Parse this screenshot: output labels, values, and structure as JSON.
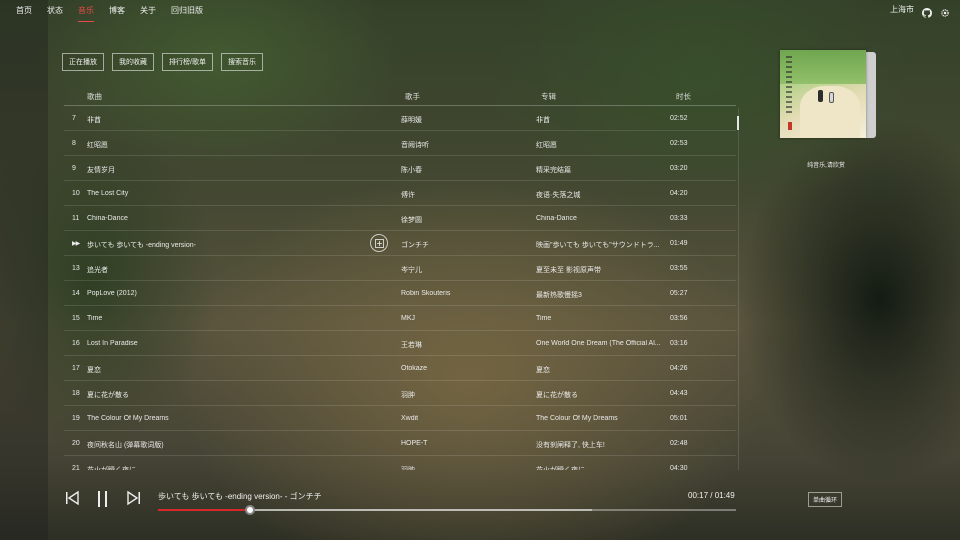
{
  "nav": {
    "items": [
      {
        "label": "首页"
      },
      {
        "label": "状态"
      },
      {
        "label": "音乐"
      },
      {
        "label": "博客"
      },
      {
        "label": "关于"
      },
      {
        "label": "回归旧版"
      }
    ],
    "active_index": 2,
    "city": "上海市",
    "icons": [
      "github-icon",
      "gear-icon"
    ]
  },
  "tabs": [
    {
      "label": "正在播放"
    },
    {
      "label": "我的收藏"
    },
    {
      "label": "排行榜/歌单"
    },
    {
      "label": "搜索音乐"
    }
  ],
  "table": {
    "headers": {
      "title": "歌曲",
      "artist": "歌手",
      "album": "专辑",
      "duration": "时长"
    },
    "rows": [
      {
        "idx": "7",
        "title": "非酋",
        "artist": "薛明媛",
        "album": "非酋",
        "duration": "02:52"
      },
      {
        "idx": "8",
        "title": "红昭愿",
        "artist": "音阙诗听",
        "album": "红昭愿",
        "duration": "02:53"
      },
      {
        "idx": "9",
        "title": "友情岁月",
        "artist": "陈小春",
        "album": "精采完结篇",
        "duration": "03:20"
      },
      {
        "idx": "10",
        "title": "The Lost City",
        "artist": "傅许",
        "album": "夜语·失落之城",
        "duration": "04:20"
      },
      {
        "idx": "11",
        "title": "China-Dance",
        "artist": "徐梦圆",
        "album": "China-Dance",
        "duration": "03:33"
      },
      {
        "idx": "▶▶",
        "title": "歩いても 歩いても -ending version-",
        "artist": "ゴンチチ",
        "album": "映画\"歩いても 歩いても\"サウンドトラ...",
        "duration": "01:49",
        "playing": true
      },
      {
        "idx": "13",
        "title": "追光者",
        "artist": "岑宁儿",
        "album": "夏至未至 影视原声带",
        "duration": "03:55"
      },
      {
        "idx": "14",
        "title": "PopLove (2012)",
        "artist": "Robin Skouteris",
        "album": "最新热歌慢摇3",
        "duration": "05:27"
      },
      {
        "idx": "15",
        "title": "Time",
        "artist": "MKJ",
        "album": "Time",
        "duration": "03:56"
      },
      {
        "idx": "16",
        "title": "Lost In Paradise",
        "artist": "王若琳",
        "album": "One World One Dream (The Official Al...",
        "duration": "03:16"
      },
      {
        "idx": "17",
        "title": "夏恋",
        "artist": "Otokaze",
        "album": "夏恋",
        "duration": "04:26"
      },
      {
        "idx": "18",
        "title": "夏に花が散る",
        "artist": "羽肿",
        "album": "夏に花が散る",
        "duration": "04:43"
      },
      {
        "idx": "19",
        "title": "The Colour Of My Dreams",
        "artist": "Xwdit",
        "album": "The Colour Of My Dreams",
        "duration": "05:01"
      },
      {
        "idx": "20",
        "title": "夜间秋名山 (弹幕歌词版)",
        "artist": "HOPE-T",
        "album": "没有刹闸释了, 快上车!",
        "duration": "02:48"
      },
      {
        "idx": "21",
        "title": "花火が瞬く夜に",
        "artist": "羽肿",
        "album": "花火が瞬く夜に",
        "duration": "04:30"
      }
    ]
  },
  "album_panel": {
    "caption": "纯音乐,请欣赏"
  },
  "player": {
    "now_playing": "歩いても 歩いても -ending version- - ゴンチチ",
    "time": "00:17 / 01:49",
    "progress_fraction": 0.16,
    "buffer_fraction": 0.75,
    "mode_label": "单曲循环",
    "accent": "#d62828"
  }
}
